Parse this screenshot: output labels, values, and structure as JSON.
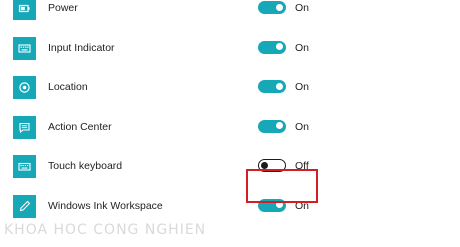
{
  "settings": [
    {
      "label": "Power",
      "icon": "power-icon",
      "state": "On",
      "enabled": true
    },
    {
      "label": "Input Indicator",
      "icon": "keyboard-icon",
      "state": "On",
      "enabled": true
    },
    {
      "label": "Location",
      "icon": "location-icon",
      "state": "On",
      "enabled": true
    },
    {
      "label": "Action Center",
      "icon": "action-center-icon",
      "state": "On",
      "enabled": true
    },
    {
      "label": "Touch keyboard",
      "icon": "touch-keyboard-icon",
      "state": "Off",
      "enabled": false
    },
    {
      "label": "Windows Ink Workspace",
      "icon": "pen-icon",
      "state": "On",
      "enabled": true
    }
  ],
  "highlighted_setting": "Touch keyboard",
  "colors": {
    "accent": "#17a8b8",
    "highlight_border": "#d21f26"
  },
  "watermark": "KHOA HOC CONG NGHIEN"
}
